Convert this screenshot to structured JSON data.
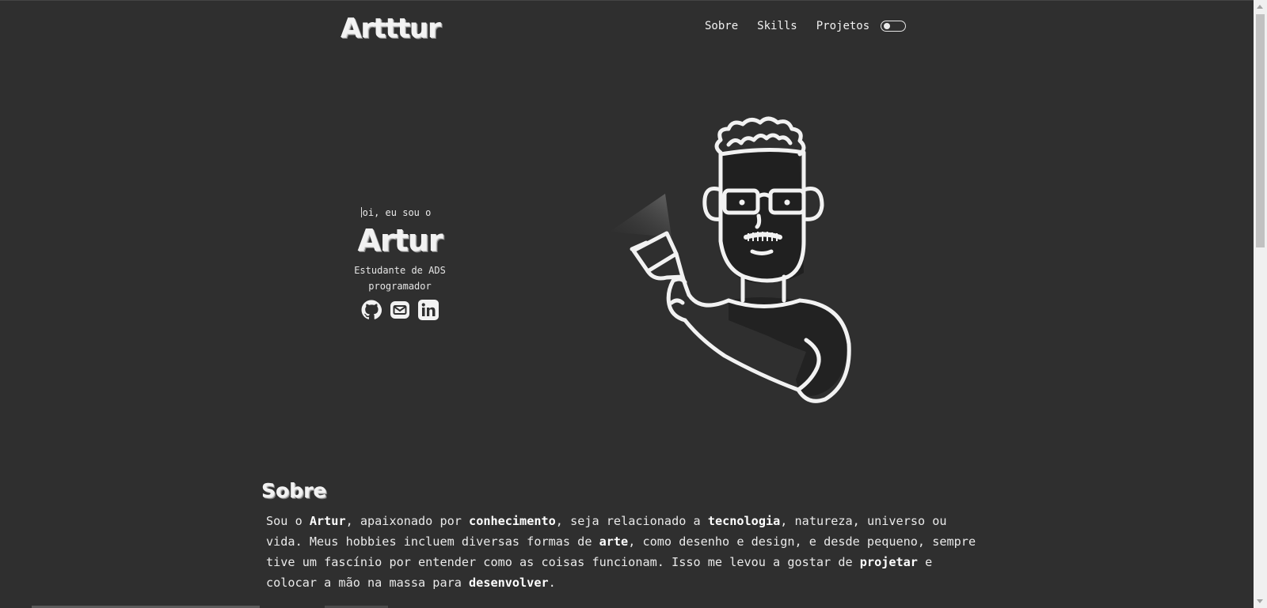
{
  "header": {
    "logo": "Artttur",
    "nav": [
      "Sobre",
      "Skills",
      "Projetos"
    ],
    "theme_toggle": "dark-mode-toggle"
  },
  "hero": {
    "greeting": "oi, eu sou o",
    "name": "Artur",
    "role_line_1": "Estudante de ADS",
    "role_line_2": "programador",
    "socials": [
      "github-icon",
      "mail-icon",
      "linkedin-icon"
    ],
    "illustration": "avatar-with-flashlight"
  },
  "about": {
    "title": "Sobre",
    "p1": "Sou o ",
    "b1": "Artur",
    "p2": ", apaixonado por ",
    "b2": "conhecimento",
    "p3": ", seja relacionado a ",
    "b3": "tecnologia",
    "p4": ", natureza, universo ou vida. Meus hobbies incluem diversas formas de ",
    "b4": "arte",
    "p5": ", como desenho e design, e desde pequeno, sempre tive um fascínio por entender como as coisas funcionam. Isso me levou a gostar de ",
    "b5": "projetar",
    "p6": " e colocar a mão na massa para ",
    "b6": "desenvolver",
    "p7": "."
  },
  "colors": {
    "background": "#2f2f2f",
    "text": "#f1f1f1"
  }
}
